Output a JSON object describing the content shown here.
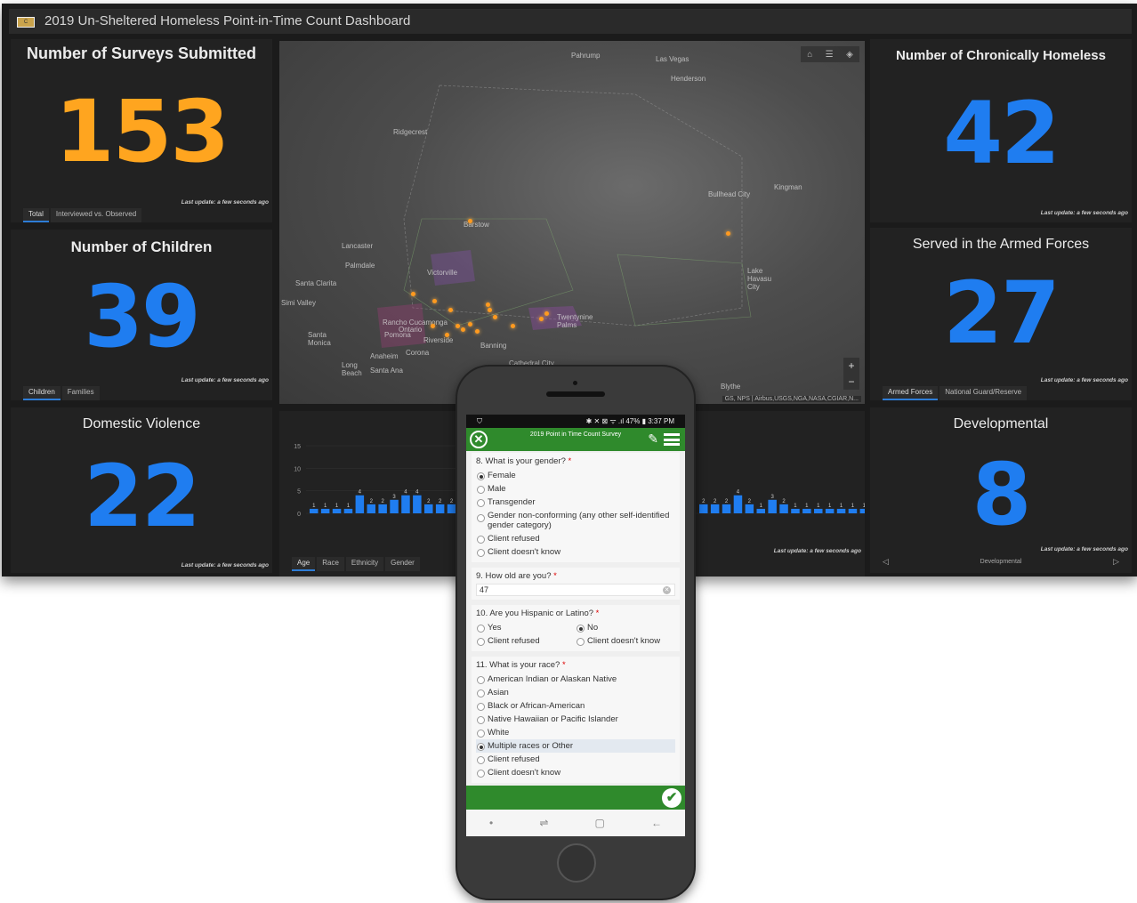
{
  "dashboard": {
    "title": "2019 Un-Sheltered Homeless Point-in-Time Count Dashboard",
    "logo_text": "C"
  },
  "indicators": {
    "surveys": {
      "title": "Number of Surveys Submitted",
      "value": "153",
      "color": "#ffa51f",
      "update": "Last update: a few seconds ago",
      "tabs": [
        "Total",
        "Interviewed vs. Observed"
      ]
    },
    "children": {
      "title": "Number of Children",
      "value": "39",
      "color": "#1f7df0",
      "update": "Last update: a few seconds ago",
      "tabs": [
        "Children",
        "Families"
      ]
    },
    "domestic": {
      "title": "Domestic Violence",
      "value": "22",
      "color": "#1f7df0",
      "update": "Last update: a few seconds ago"
    },
    "chronic": {
      "title": "Number of Chronically Homeless",
      "value": "42",
      "color": "#1f7df0",
      "update": "Last update: a few seconds ago"
    },
    "armed": {
      "title": "Served in the Armed Forces",
      "value": "27",
      "color": "#1f7df0",
      "update": "Last update: a few seconds ago",
      "tabs": [
        "Armed Forces",
        "National Guard/Reserve"
      ]
    },
    "developmental": {
      "title": "Developmental",
      "value": "8",
      "color": "#1f7df0",
      "update": "Last update: a few seconds ago",
      "footer": "Developmental"
    }
  },
  "map": {
    "labels": [
      "Pahrump",
      "Las Vegas",
      "Henderson",
      "Ridgecrest",
      "Bullhead City",
      "Kingman",
      "Barstow",
      "Lancaster",
      "Palmdale",
      "Victorville",
      "Santa Clarita",
      "Simi Valley",
      "Lake Havasu City",
      "Rancho Cucamonga",
      "Ontario",
      "Pomona",
      "Twentynine Palms",
      "Riverside",
      "Banning",
      "Santa Monica",
      "Anaheim",
      "Corona",
      "Long Beach",
      "Santa Ana",
      "Cathedral City",
      "Blythe"
    ],
    "attribution": "GS, NPS | Airbus,USGS,NGA,NASA,CGIAR,N...",
    "zoom_in": "+",
    "zoom_out": "−"
  },
  "age_chart": {
    "update": "Last update: a few seconds ago",
    "tabs": [
      "Age",
      "Race",
      "Ethnicity",
      "Gender"
    ]
  },
  "chart_data": [
    {
      "type": "bar",
      "yticks": [
        "15",
        "10",
        "5",
        "0"
      ],
      "ylim": [
        0,
        15
      ],
      "values": [
        1,
        1,
        1,
        1,
        4,
        2,
        2,
        3,
        4,
        4,
        2,
        2,
        2,
        2,
        2
      ],
      "labels": [
        "1",
        "1",
        "1",
        "1",
        "4",
        "2",
        "2",
        "3",
        "4",
        "4",
        "2",
        "2",
        "2",
        "2",
        "2"
      ],
      "color": "#1f7df0"
    },
    {
      "type": "bar",
      "values": [
        2,
        2,
        2,
        4,
        2,
        1,
        3,
        2,
        1,
        1,
        1,
        1,
        1,
        1,
        1
      ],
      "labels": [
        "2",
        "2",
        "2",
        "4",
        "2",
        "1",
        "3",
        "2",
        "1",
        "1",
        "1",
        "1",
        "1",
        "1",
        "1"
      ],
      "color": "#1f7df0"
    }
  ],
  "phone": {
    "status": "✱ ✕ ⊠ ᯤ .ıl 47% ▮ 3:37 PM",
    "app_title": "2019 Point in Time Count Survey",
    "q8": {
      "label": "8. What is your gender?",
      "options": [
        "Female",
        "Male",
        "Transgender",
        "Gender non-conforming (any other self-identified gender category)",
        "Client refused",
        "Client doesn't know"
      ],
      "selected": "Female"
    },
    "q9": {
      "label": "9. How old are you?",
      "value": "47"
    },
    "q10": {
      "label": "10. Are you Hispanic or Latino?",
      "options": [
        "Yes",
        "No",
        "Client refused",
        "Client doesn't know"
      ],
      "selected": "No"
    },
    "q11": {
      "label": "11. What is your race?",
      "options": [
        "American Indian or Alaskan Native",
        "Asian",
        "Black or African-American",
        "Native Hawaiian or Pacific Islander",
        "White",
        "Multiple races or Other",
        "Client refused",
        "Client doesn't know"
      ],
      "selected": "Multiple races or Other"
    },
    "required_mark": "*"
  }
}
